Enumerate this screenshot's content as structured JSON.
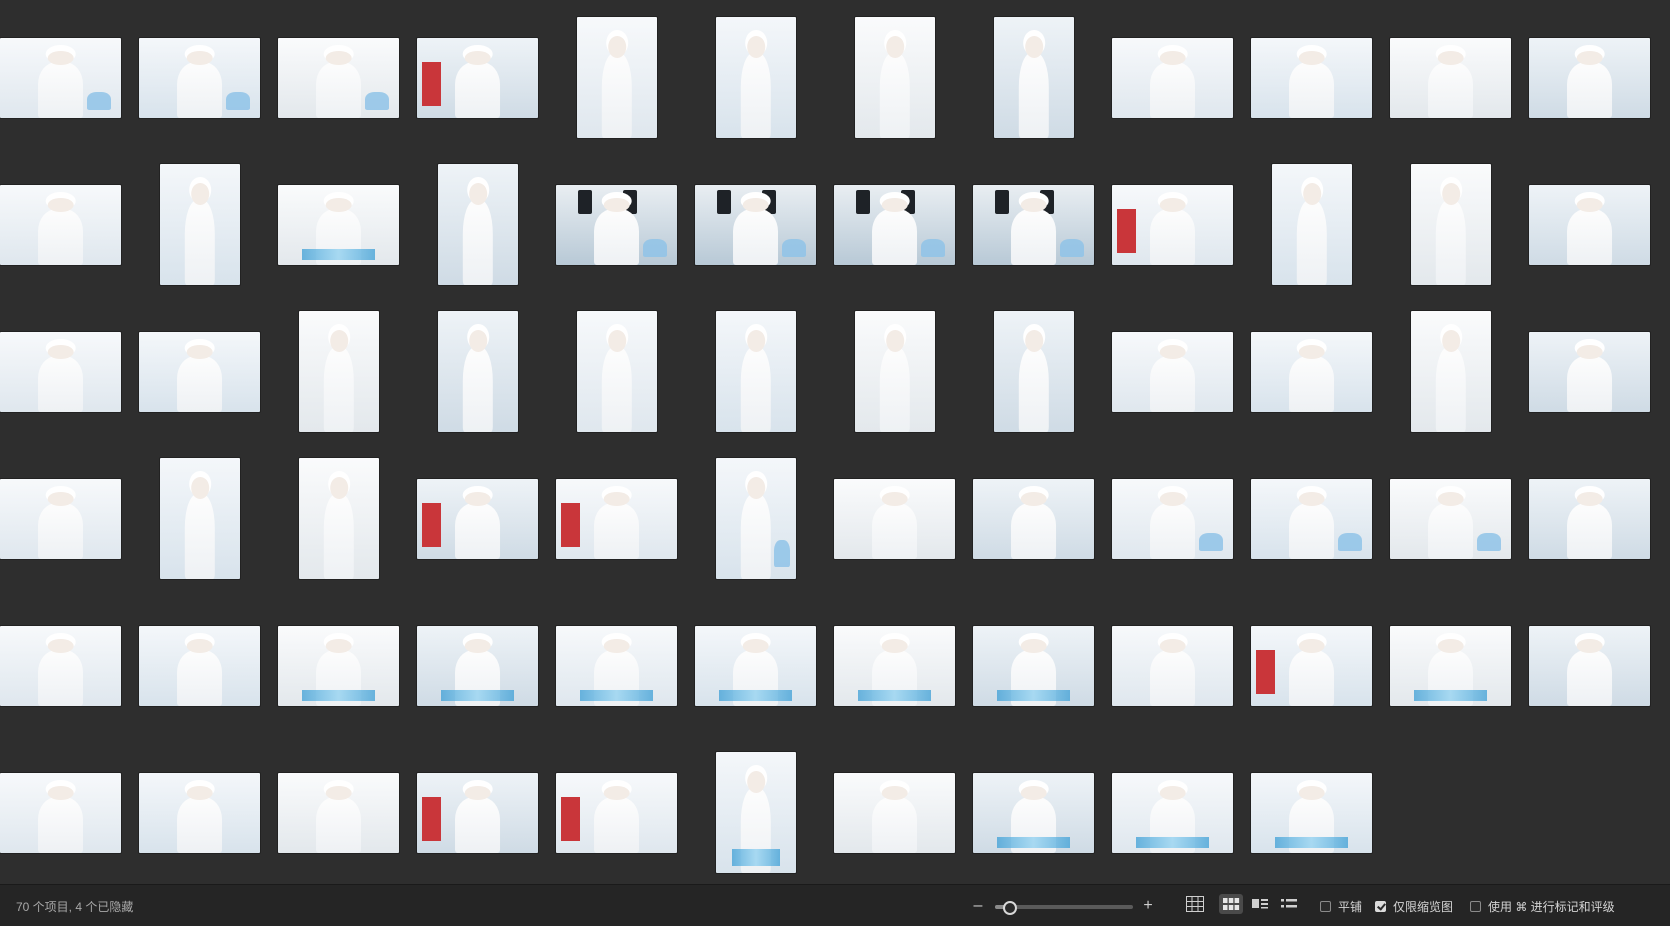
{
  "status": {
    "item_count": "70 个项目, 4 个已隐藏",
    "zoom_level": 0.1
  },
  "zoom": {
    "minus_symbol": "–",
    "plus_symbol": "+"
  },
  "view_modes": {
    "selected": "grid-large",
    "items": [
      "grid-small",
      "grid-large",
      "gallery",
      "list"
    ]
  },
  "options": {
    "tile_label": "平铺",
    "tile_checked": false,
    "thumbs_only_label": "仅限缩览图",
    "thumbs_only_checked": true,
    "use_cmd_label": "使用 ⌘ 进行标记和评级",
    "use_cmd_checked": false
  },
  "colors": {
    "background": "#2e2e2e",
    "statusbar": "#252525",
    "photo_white": "#f4f6f8",
    "glove_blue": "#3d9fd6",
    "brand_red": "#c9363a"
  },
  "thumbnails": [
    {
      "o": "L",
      "t": "team-blue"
    },
    {
      "o": "L",
      "t": "team-blue"
    },
    {
      "o": "L",
      "t": "team-blue"
    },
    {
      "o": "L",
      "t": "sign"
    },
    {
      "o": "P",
      "t": "portrait"
    },
    {
      "o": "P",
      "t": "portrait"
    },
    {
      "o": "P",
      "t": "portrait"
    },
    {
      "o": "P",
      "t": "portrait"
    },
    {
      "o": "L",
      "t": "plain"
    },
    {
      "o": "L",
      "t": "plain"
    },
    {
      "o": "L",
      "t": "plain"
    },
    {
      "o": "L",
      "t": "plain"
    },
    {
      "o": "L",
      "t": "plain"
    },
    {
      "o": "P",
      "t": "portrait"
    },
    {
      "o": "L",
      "t": "glove"
    },
    {
      "o": "P",
      "t": "plain"
    },
    {
      "o": "L",
      "t": "camera"
    },
    {
      "o": "L",
      "t": "camera"
    },
    {
      "o": "L",
      "t": "camera"
    },
    {
      "o": "L",
      "t": "camera"
    },
    {
      "o": "L",
      "t": "sign"
    },
    {
      "o": "P",
      "t": "portrait"
    },
    {
      "o": "P",
      "t": "portrait"
    },
    {
      "o": "L",
      "t": "plain"
    },
    {
      "o": "L",
      "t": "plain"
    },
    {
      "o": "L",
      "t": "plain"
    },
    {
      "o": "P",
      "t": "portrait"
    },
    {
      "o": "P",
      "t": "portrait"
    },
    {
      "o": "P",
      "t": "portrait"
    },
    {
      "o": "P",
      "t": "portrait"
    },
    {
      "o": "P",
      "t": "portrait"
    },
    {
      "o": "P",
      "t": "portrait"
    },
    {
      "o": "L",
      "t": "plain"
    },
    {
      "o": "L",
      "t": "plain"
    },
    {
      "o": "P",
      "t": "portrait"
    },
    {
      "o": "L",
      "t": "plain"
    },
    {
      "o": "L",
      "t": "plain"
    },
    {
      "o": "P",
      "t": "portrait"
    },
    {
      "o": "P",
      "t": "portrait"
    },
    {
      "o": "L",
      "t": "sign"
    },
    {
      "o": "L",
      "t": "sign"
    },
    {
      "o": "P",
      "t": "team-blue"
    },
    {
      "o": "L",
      "t": "plain"
    },
    {
      "o": "L",
      "t": "plain"
    },
    {
      "o": "L",
      "t": "team-blue"
    },
    {
      "o": "L",
      "t": "team-blue"
    },
    {
      "o": "L",
      "t": "team-blue"
    },
    {
      "o": "L",
      "t": "plain"
    },
    {
      "o": "L",
      "t": "plain"
    },
    {
      "o": "L",
      "t": "plain"
    },
    {
      "o": "L",
      "t": "glove"
    },
    {
      "o": "L",
      "t": "glove"
    },
    {
      "o": "L",
      "t": "glove"
    },
    {
      "o": "L",
      "t": "glove"
    },
    {
      "o": "L",
      "t": "glove"
    },
    {
      "o": "L",
      "t": "glove"
    },
    {
      "o": "L",
      "t": "plain"
    },
    {
      "o": "L",
      "t": "sign"
    },
    {
      "o": "L",
      "t": "glove"
    },
    {
      "o": "L",
      "t": "plain"
    },
    {
      "o": "L",
      "t": "plain"
    },
    {
      "o": "L",
      "t": "plain"
    },
    {
      "o": "L",
      "t": "plain"
    },
    {
      "o": "L",
      "t": "sign"
    },
    {
      "o": "L",
      "t": "sign"
    },
    {
      "o": "P",
      "t": "glove"
    },
    {
      "o": "L",
      "t": "plain"
    },
    {
      "o": "L",
      "t": "glove"
    },
    {
      "o": "L",
      "t": "glove"
    },
    {
      "o": "L",
      "t": "glove"
    }
  ]
}
